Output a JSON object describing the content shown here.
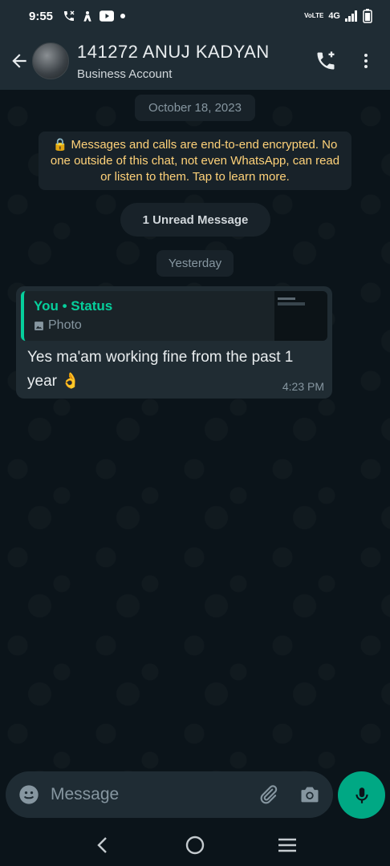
{
  "status_bar": {
    "time": "9:55",
    "network": "4G",
    "volte": "VoLTE"
  },
  "header": {
    "contact_name": "141272 ANUJ KADYAN",
    "subtitle": "Business Account"
  },
  "chat": {
    "date_chip": "October 18, 2023",
    "encryption_notice": "🔒 Messages and calls are end-to-end encrypted. No one outside of this chat, not even WhatsApp, can read or listen to them. Tap to learn more.",
    "unread_label": "1 Unread Message",
    "yesterday_chip": "Yesterday",
    "messages": [
      {
        "quote_author": "You • Status",
        "quote_type": "Photo",
        "text": "Yes ma'am working fine from the past 1 year 👌",
        "time": "4:23 PM"
      }
    ]
  },
  "composer": {
    "placeholder": "Message"
  },
  "colors": {
    "accent": "#00a884",
    "quote_accent": "#06cf9c",
    "encryption_text": "#ffd279",
    "background": "#0b141a"
  }
}
